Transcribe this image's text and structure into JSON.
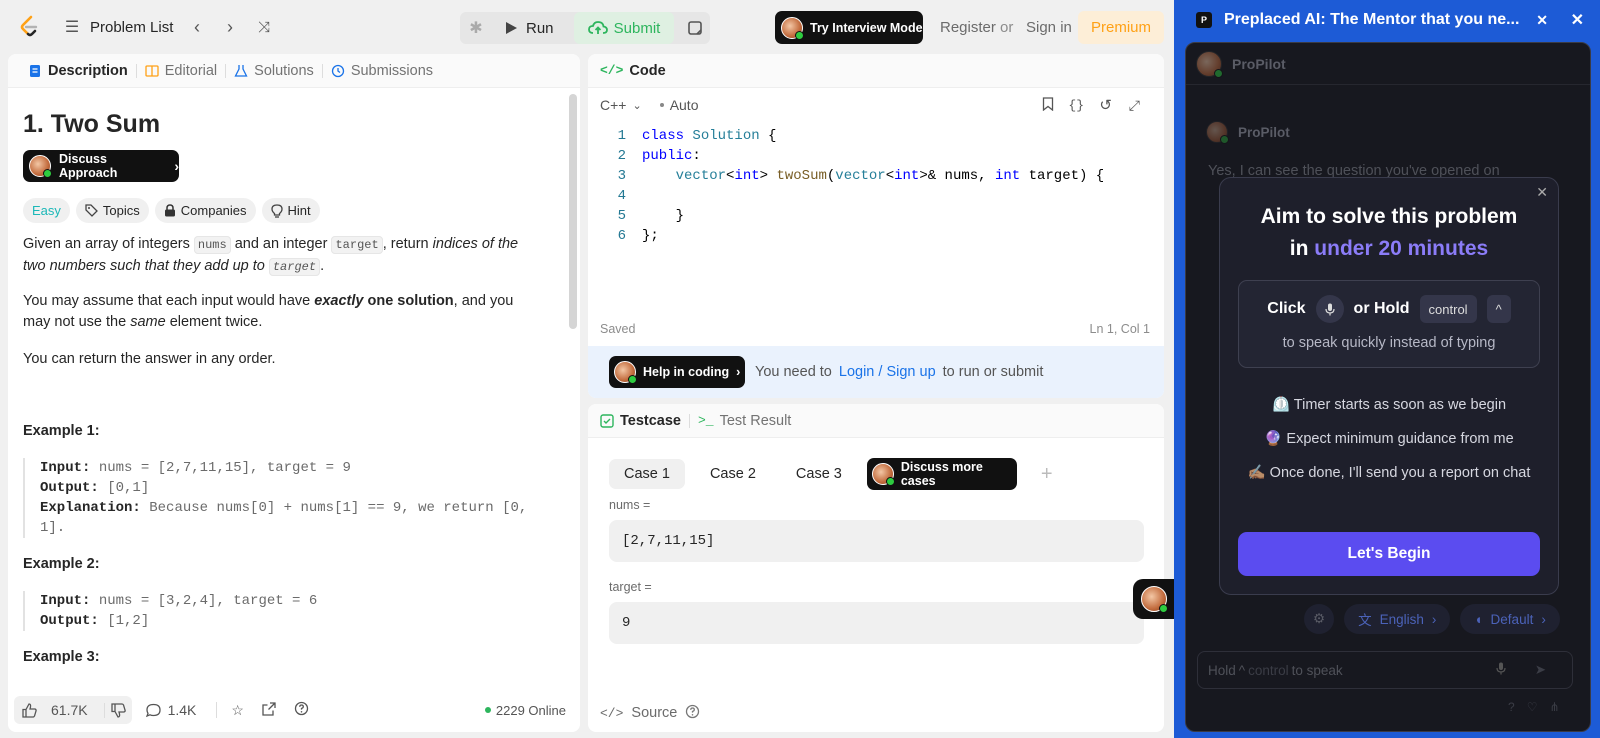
{
  "topbar": {
    "problem_list": "Problem List",
    "run": "Run",
    "submit": "Submit",
    "interview": "Try Interview Mode",
    "register": "Register",
    "or": "or",
    "sign_in": "Sign in",
    "premium": "Premium"
  },
  "desc": {
    "tabs": [
      "Description",
      "Editorial",
      "Solutions",
      "Submissions"
    ],
    "title": "1. Two Sum",
    "discuss_btn": "Discuss Approach",
    "pills": [
      "Easy",
      "Topics",
      "Companies",
      "Hint"
    ],
    "p1_a": "Given an array of integers ",
    "p1_code1": "nums",
    "p1_b": " and an integer ",
    "p1_code2": "target",
    "p1_c": ", return ",
    "p1_em": "indices of the two numbers such that they add up to",
    "p1_code3": "target",
    "p1_d": ".",
    "p2_a": "You may assume that each input would have ",
    "p2_em": "exactly",
    "p2_b": " one solution",
    "p2_c": ", and you may not use the ",
    "p2_same": "same",
    "p2_d": " element twice.",
    "p3": "You can return the answer in any order.",
    "ex1_title": "Example 1:",
    "ex1_input_label": "Input:",
    "ex1_input": "nums = [2,7,11,15], target = 9",
    "ex1_output_label": "Output:",
    "ex1_output": "[0,1]",
    "ex1_expl_label": "Explanation:",
    "ex1_expl": "Because nums[0] + nums[1] == 9, we return [0, 1].",
    "ex2_title": "Example 2:",
    "ex2_input_label": "Input:",
    "ex2_input": "nums = [3,2,4], target = 6",
    "ex2_output_label": "Output:",
    "ex2_output": "[1,2]",
    "ex3_title": "Example 3:",
    "likes": "61.7K",
    "comments": "1.4K",
    "online": "2229 Online"
  },
  "code": {
    "tab": "Code",
    "lang": "C++",
    "auto": "Auto",
    "line_numbers": [
      "1",
      "2",
      "3",
      "4",
      "5",
      "6"
    ],
    "saved": "Saved",
    "cursor": "Ln 1, Col 1",
    "help_btn": "Help in coding",
    "need_to": "You need to",
    "login": "Login / Sign up",
    "to_run": "to run or submit"
  },
  "test": {
    "tab1": "Testcase",
    "tab2": "Test Result",
    "cases": [
      "Case 1",
      "Case 2",
      "Case 3"
    ],
    "more_btn": "Discuss more cases",
    "nums_label": "nums =",
    "nums_value": "[2,7,11,15]",
    "target_label": "target =",
    "target_value": "9",
    "source": "Source"
  },
  "side": {
    "title": "Preplaced AI: The Mentor that you ne...",
    "bot_name": "ProPilot",
    "bot_name2": "ProPilot",
    "chat_first": "Yes, I can see the question you've opened on",
    "modal_title_1": "Aim to solve this problem",
    "modal_title_2": "in ",
    "modal_title_accent": "under 20 minutes",
    "click": "Click",
    "or_hold": "or Hold",
    "control": "control",
    "hint_sub": "to speak quickly instead of typing",
    "b1": "⏲️ Timer starts as soon as we begin",
    "b2": "🔮 Expect minimum guidance from me",
    "b3": "✍🏽 Once done, I'll send you a report on chat",
    "begin": "Let's Begin",
    "english": "English",
    "default": "Default",
    "input_hold": "Hold",
    "input_control": "control",
    "input_speak": "to speak"
  }
}
